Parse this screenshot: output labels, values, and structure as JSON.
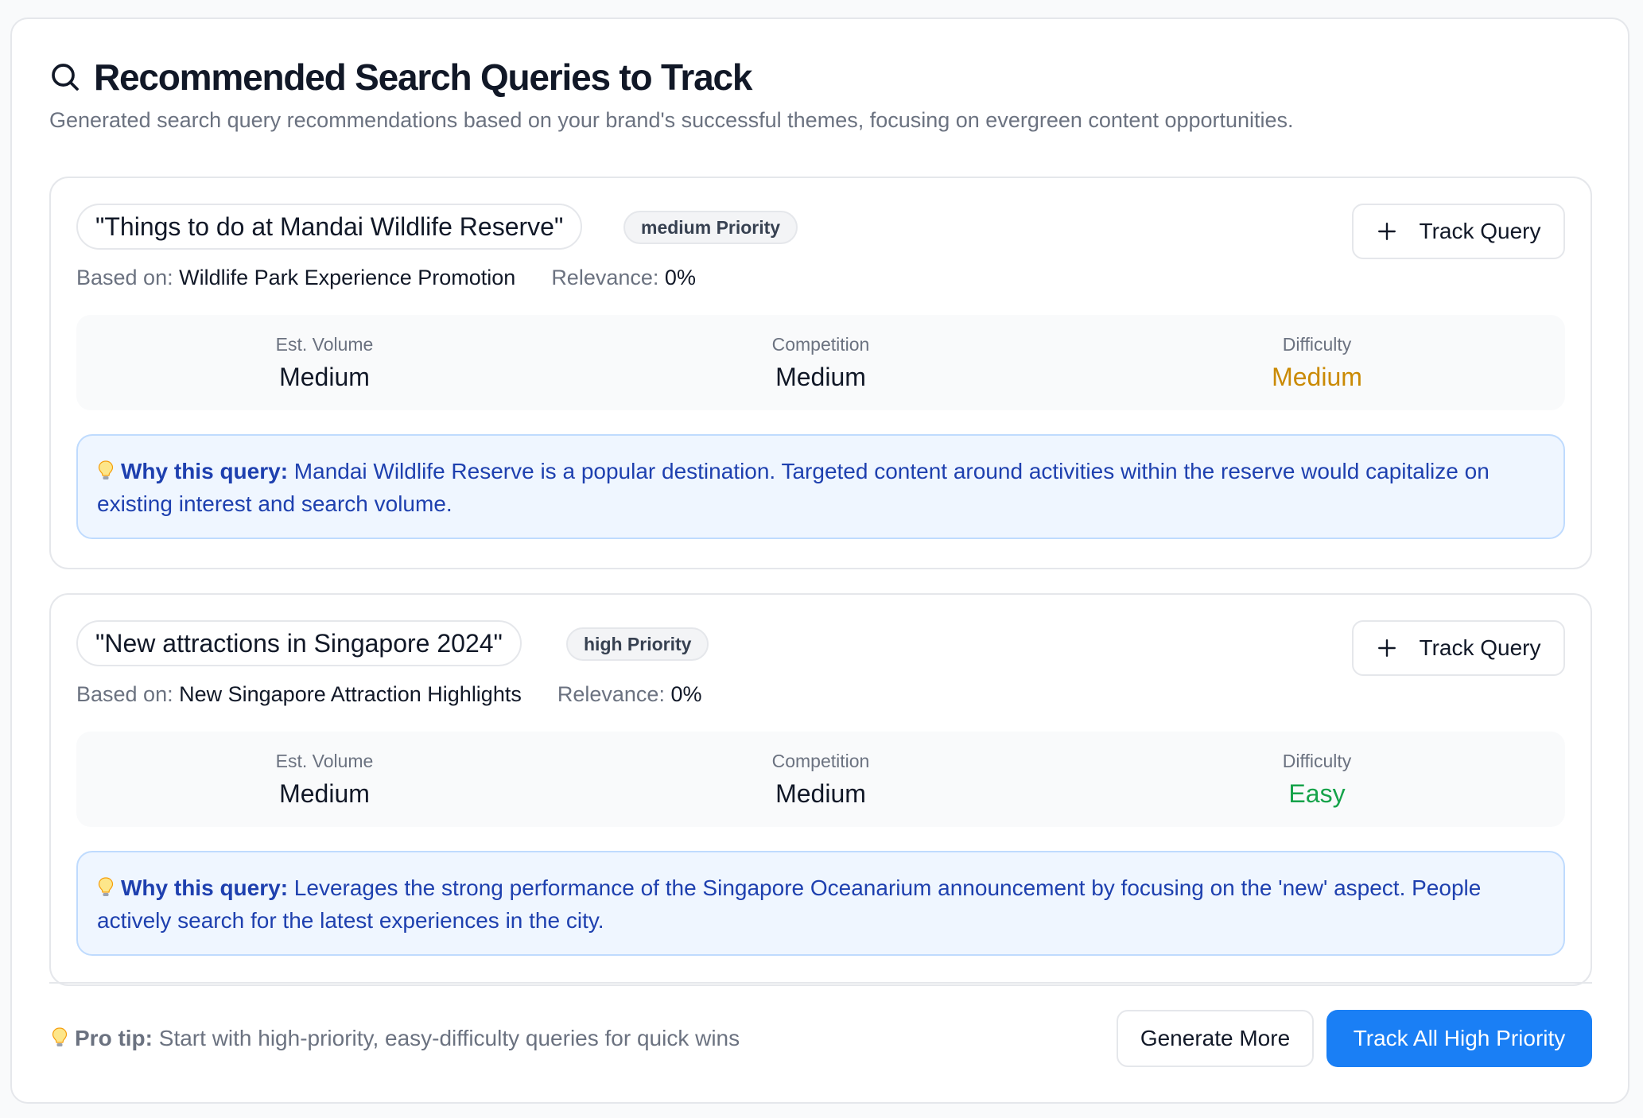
{
  "header": {
    "title": "Recommended Search Queries to Track",
    "subtitle": "Generated search query recommendations based on your brand's successful themes, focusing on evergreen content opportunities."
  },
  "queries": [
    {
      "query": "\"Things to do at Mandai Wildlife Reserve\"",
      "priority": "medium Priority",
      "track_label": "Track Query",
      "based_on_label": "Based on:",
      "based_on": "Wildlife Park Experience Promotion",
      "relevance_label": "Relevance:",
      "relevance": "0%",
      "stats": [
        {
          "label": "Est. Volume",
          "value": "Medium"
        },
        {
          "label": "Competition",
          "value": "Medium"
        },
        {
          "label": "Difficulty",
          "value": "Medium"
        }
      ],
      "difficulty_color": "#ca8a04",
      "why_label": "Why this query:",
      "why_text": "Mandai Wildlife Reserve is a popular destination. Targeted content around activities within the reserve would capitalize on existing interest and search volume."
    },
    {
      "query": "\"New attractions in Singapore 2024\"",
      "priority": "high Priority",
      "track_label": "Track Query",
      "based_on_label": "Based on:",
      "based_on": "New Singapore Attraction Highlights",
      "relevance_label": "Relevance:",
      "relevance": "0%",
      "stats": [
        {
          "label": "Est. Volume",
          "value": "Medium"
        },
        {
          "label": "Competition",
          "value": "Medium"
        },
        {
          "label": "Difficulty",
          "value": "Easy"
        }
      ],
      "difficulty_color": "#16a34a",
      "why_label": "Why this query:",
      "why_text": "Leverages the strong performance of the Singapore Oceanarium announcement by focusing on the 'new' aspect. People actively search for the latest experiences in the city."
    }
  ],
  "footer": {
    "tip_label": "Pro tip:",
    "tip_text": "Start with high-priority, easy-difficulty queries for quick wins",
    "generate_label": "Generate More",
    "track_all_label": "Track All High Priority"
  },
  "colors": {
    "accent": "#1a7ff5",
    "why_bg": "#eff6ff",
    "why_text": "#1e40af"
  }
}
